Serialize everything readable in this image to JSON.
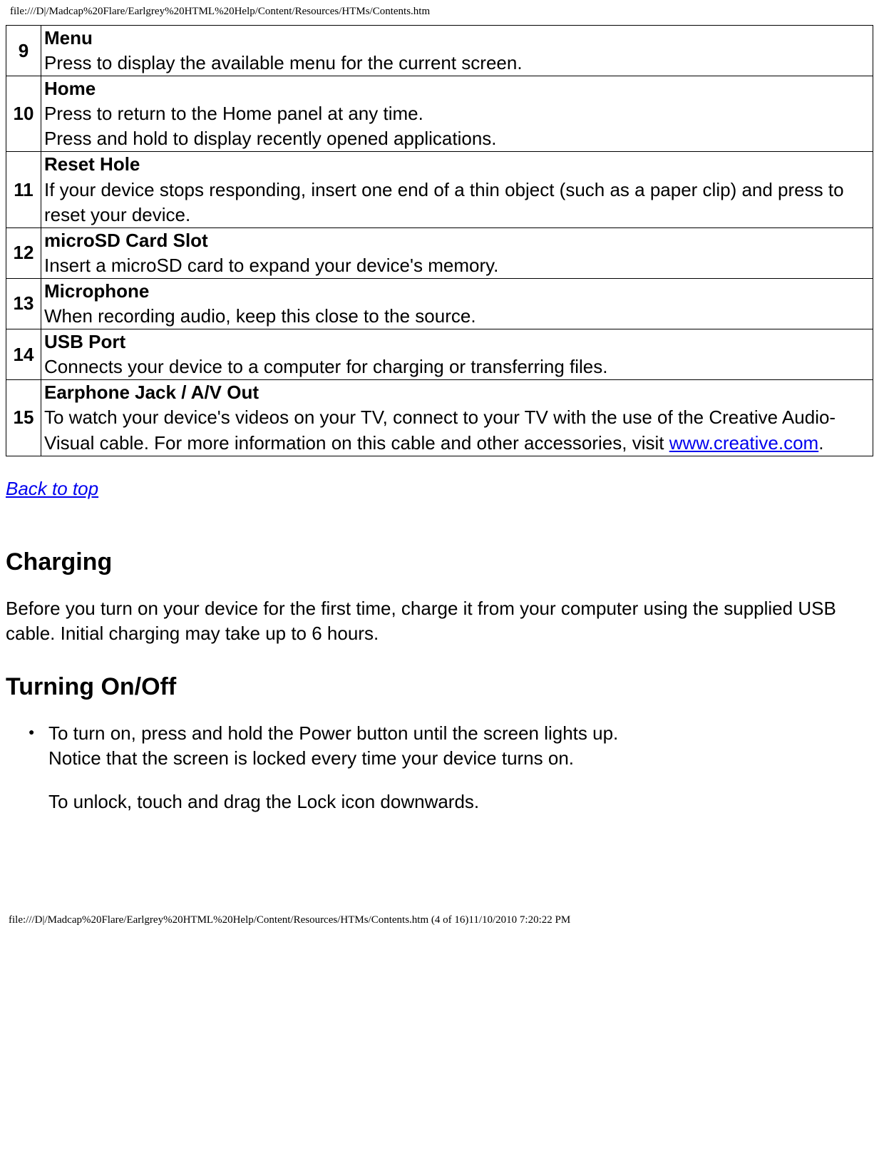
{
  "header_path": "file:///D|/Madcap%20Flare/Earlgrey%20HTML%20Help/Content/Resources/HTMs/Contents.htm",
  "footer_path": "file:///D|/Madcap%20Flare/Earlgrey%20HTML%20Help/Content/Resources/HTMs/Contents.htm (4 of 16)11/10/2010 7:20:22 PM",
  "rows": [
    {
      "num": "9",
      "title": "Menu",
      "desc": "Press to display the available menu for the current screen."
    },
    {
      "num": "10",
      "title": "Home",
      "desc": "Press to return to the Home panel at any time.\nPress and hold to display recently opened applications."
    },
    {
      "num": "11",
      "title": "Reset Hole",
      "desc": "If your device stops responding, insert one end of a thin object (such as a paper clip) and press to reset your device."
    },
    {
      "num": "12",
      "title": "microSD Card Slot",
      "desc": "Insert a microSD card to expand your device's memory."
    },
    {
      "num": "13",
      "title": "Microphone",
      "desc": "When recording audio, keep this close to the source."
    },
    {
      "num": "14",
      "title": "USB Port",
      "desc": "Connects your device to a computer for charging or transferring files."
    },
    {
      "num": "15",
      "title": "Earphone Jack / A/V Out",
      "desc_pre": "To watch your device's videos on your TV, connect to your TV with the use of the Creative Audio-Visual cable. For more information on this cable and other accessories, visit ",
      "link_text": "www.creative.com",
      "desc_post": "."
    }
  ],
  "back_to_top": "Back to top",
  "sections": {
    "charging": {
      "heading": "Charging",
      "body": "Before you turn on your device for the first time, charge it from your computer using the supplied USB cable. Initial charging may take up to 6 hours."
    },
    "turning": {
      "heading": "Turning On/Off",
      "bullet_line1": "To turn on, press and hold the Power button until the screen lights up.",
      "bullet_line2": "Notice that the screen is locked every time your device turns on.",
      "bullet_para2": "To unlock, touch and drag the Lock icon downwards."
    }
  }
}
